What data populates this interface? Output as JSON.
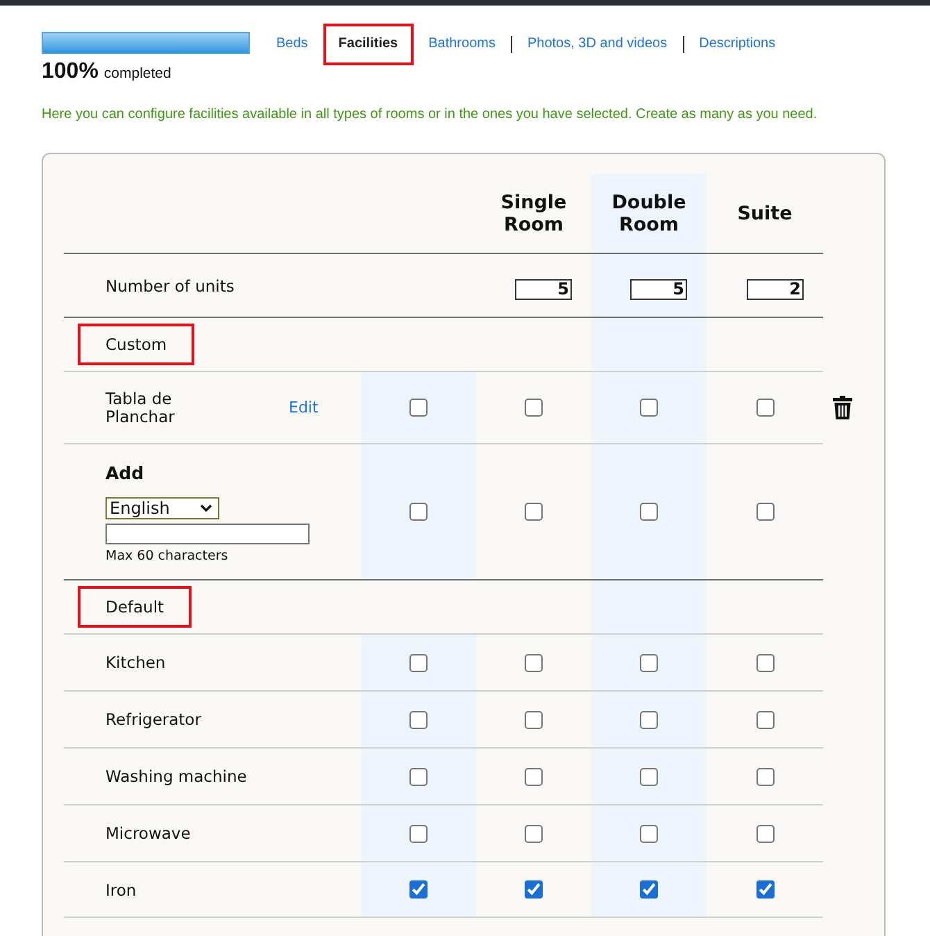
{
  "progress": {
    "level": 1,
    "percent": "100%",
    "caption": "completed"
  },
  "tabs": [
    {
      "label": "Beds",
      "selected": false,
      "highlighted": false
    },
    {
      "label": "Facilities",
      "selected": true,
      "highlighted": true
    },
    {
      "label": "Bathrooms",
      "selected": false,
      "highlighted": false
    },
    {
      "label": "Photos, 3D and videos",
      "selected": false,
      "highlighted": false
    },
    {
      "label": "Descriptions",
      "selected": false,
      "highlighted": false
    }
  ],
  "intro": "Here you can configure facilities available in all types of rooms or in the ones you have selected. Create as many as you need.",
  "table": {
    "columns": [
      {
        "label": "Single Room",
        "units": "5"
      },
      {
        "label": "Double Room",
        "units": "5"
      },
      {
        "label": "Suite",
        "units": "2"
      }
    ],
    "units_label": "Number of units",
    "sections": [
      {
        "title": "Custom",
        "highlighted": true,
        "rows": [
          {
            "kind": "custom",
            "label": "Tabla de Planchar",
            "edit": "Edit",
            "checks": [
              false,
              false,
              false,
              false
            ]
          },
          {
            "kind": "add",
            "title": "Add",
            "language": "English",
            "hint": "Max 60 characters",
            "checks": [
              false,
              false,
              false,
              false
            ]
          }
        ]
      },
      {
        "title": "Default",
        "highlighted": true,
        "rows": [
          {
            "kind": "facility",
            "label": "Kitchen",
            "checks": [
              false,
              false,
              false,
              false
            ]
          },
          {
            "kind": "facility",
            "label": "Refrigerator",
            "checks": [
              false,
              false,
              false,
              false
            ]
          },
          {
            "kind": "facility",
            "label": "Washing machine",
            "checks": [
              false,
              false,
              false,
              false
            ]
          },
          {
            "kind": "facility",
            "label": "Microwave",
            "checks": [
              false,
              false,
              false,
              false
            ]
          },
          {
            "kind": "facility",
            "label": "Iron",
            "checks": [
              true,
              true,
              true,
              true
            ]
          }
        ]
      }
    ]
  }
}
